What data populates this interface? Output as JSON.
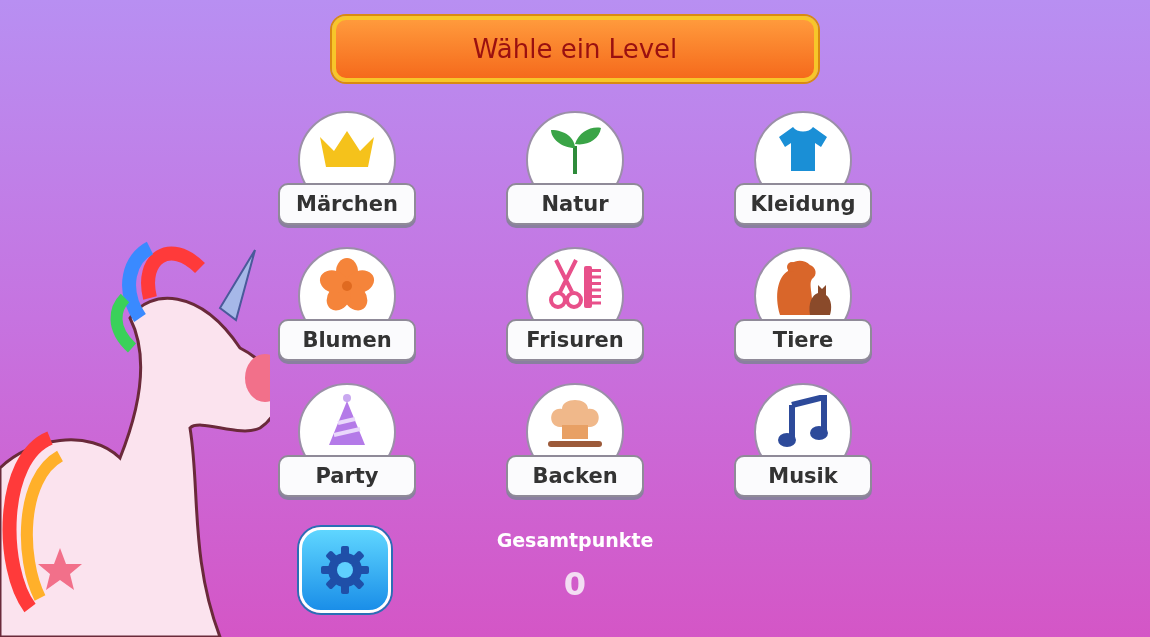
{
  "title": "Wähle ein Level",
  "levels": [
    {
      "label": "Märchen",
      "kind": "crown"
    },
    {
      "label": "Natur",
      "kind": "sprout"
    },
    {
      "label": "Kleidung",
      "kind": "shirt"
    },
    {
      "label": "Blumen",
      "kind": "flower"
    },
    {
      "label": "Frisuren",
      "kind": "scissors"
    },
    {
      "label": "Tiere",
      "kind": "animals"
    },
    {
      "label": "Party",
      "kind": "hat"
    },
    {
      "label": "Backen",
      "kind": "chef"
    },
    {
      "label": "Musik",
      "kind": "music"
    }
  ],
  "score": {
    "label": "Gesamtpunkte",
    "value": "0"
  }
}
